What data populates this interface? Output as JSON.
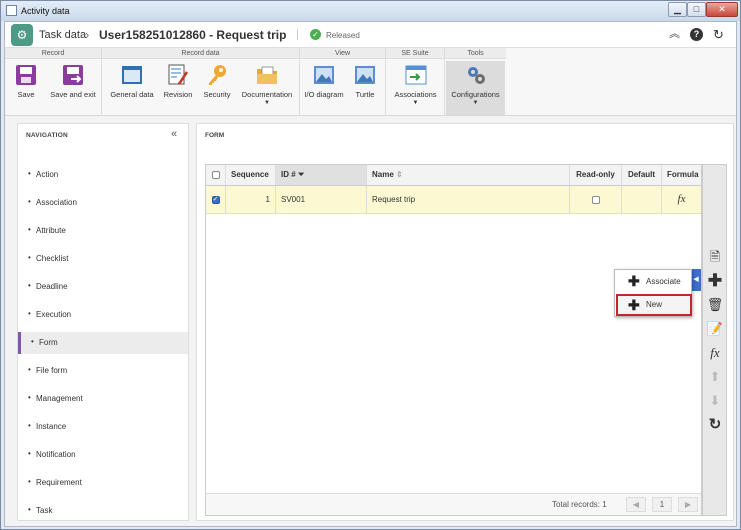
{
  "window": {
    "title": "Activity data"
  },
  "header": {
    "module": "Task data",
    "record": "User158251012860 - Request trip",
    "status": "Released"
  },
  "ribbon": {
    "groups": [
      "Record",
      "Record data",
      "View",
      "SE Suite",
      "Tools"
    ],
    "buttons": {
      "save": "Save",
      "save_exit": "Save and exit",
      "general_data": "General data",
      "revision": "Revision",
      "security": "Security",
      "documentation": "Documentation",
      "io_diagram": "I/O diagram",
      "turtle": "Turtle",
      "associations": "Associations",
      "configurations": "Configurations"
    }
  },
  "navigation": {
    "title": "NAVIGATION",
    "items": [
      "Action",
      "Association",
      "Attribute",
      "Checklist",
      "Deadline",
      "Execution",
      "Form",
      "File form",
      "Management",
      "Instance",
      "Notification",
      "Requirement",
      "Task"
    ],
    "selected": "Form"
  },
  "form": {
    "title": "FORM",
    "columns": [
      "Sequence",
      "ID #",
      "Name",
      "Read-only",
      "Default",
      "Formula"
    ],
    "rows": [
      {
        "sequence": "1",
        "id": "SV001",
        "name": "Request trip",
        "formula": "fx"
      }
    ],
    "total_records": "Total records: 1",
    "page": "1"
  },
  "popup": {
    "associate": "Associate",
    "new": "New"
  },
  "colors": {
    "accent": "#3b6fc9",
    "selection": "#7d5aa6",
    "highlight_border": "#c0282d",
    "row_selected": "#fbf8d2"
  }
}
